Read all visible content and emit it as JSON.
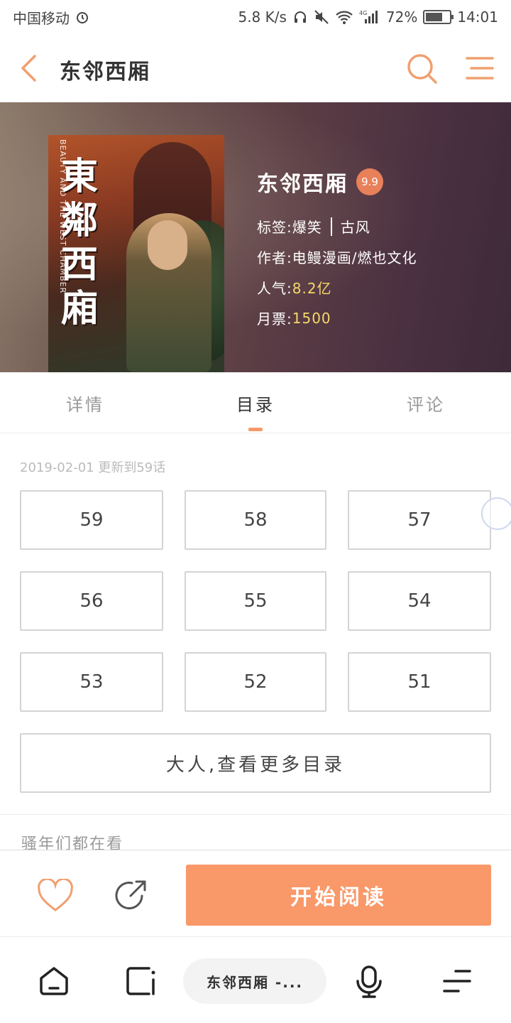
{
  "status_bar": {
    "carrier": "中国移动",
    "net_speed": "5.8 K/s",
    "network_type": "4G",
    "battery_percent": "72%",
    "battery_level": 0.72,
    "time": "14:01"
  },
  "header": {
    "title": "东邻西厢",
    "accent_color": "#f0a070"
  },
  "book": {
    "cover_title": "東鄰西廂",
    "cover_subtitle": "BEAUTY AND THE WEST CHAMBER",
    "title": "东邻西厢",
    "score": "9.9",
    "tags_label": "标签:",
    "tags": [
      "爆笑",
      "古风"
    ],
    "author_label": "作者:",
    "author": "电鳗漫画/燃也文化",
    "popularity_label": "人气:",
    "popularity": "8.2亿",
    "tickets_label": "月票:",
    "tickets": "1500"
  },
  "tabs": [
    {
      "label": "详情",
      "active": false
    },
    {
      "label": "目录",
      "active": true
    },
    {
      "label": "评论",
      "active": false
    }
  ],
  "catalog": {
    "update_info": "2019-02-01 更新到59话",
    "chapters": [
      "59",
      "58",
      "57",
      "56",
      "55",
      "54",
      "53",
      "52",
      "51"
    ],
    "more_label": "大人,查看更多目录"
  },
  "section_title": "骚年们都在看",
  "actions": {
    "read_label": "开始阅读",
    "read_color": "#f99869"
  },
  "browser_nav": {
    "page_label": "东邻西厢 -..."
  }
}
